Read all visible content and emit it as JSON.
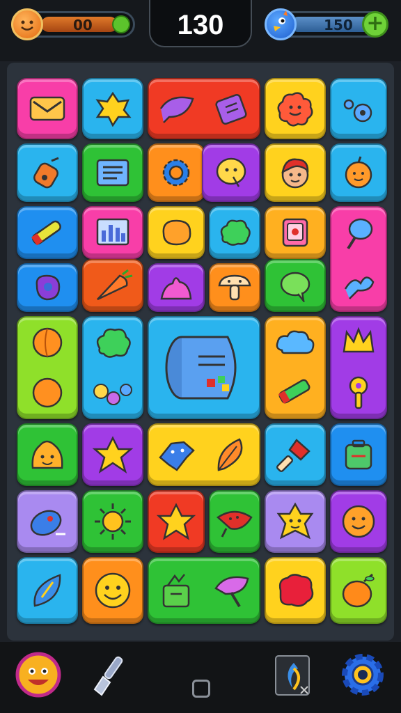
{
  "hud": {
    "left_counter": {
      "value": "00",
      "avatar_icon": "smiley-coin-icon",
      "action_icon": "green-circle-icon"
    },
    "score": "130",
    "right_counter": {
      "value": "150",
      "avatar_icon": "blue-bird-icon",
      "action_icon": "plus-icon",
      "plus_label": "+"
    }
  },
  "board": {
    "background": "#2c333c",
    "tile_colors": {
      "pink": "#f83ea8",
      "sky": "#2ab4ee",
      "red": "#f03a24",
      "yellow": "#ffd21e",
      "blue": "#1f8ff0",
      "green": "#2fc236",
      "orange": "#ff8f1c",
      "purple": "#a13ce6",
      "lime": "#8fe02a",
      "lavender": "#a98af0"
    }
  },
  "bottom_bar": {
    "icons": [
      "smiley-face-icon",
      "spatula-icon",
      "home-square-icon",
      "card-swap-icon",
      "settings-gear-icon"
    ]
  }
}
